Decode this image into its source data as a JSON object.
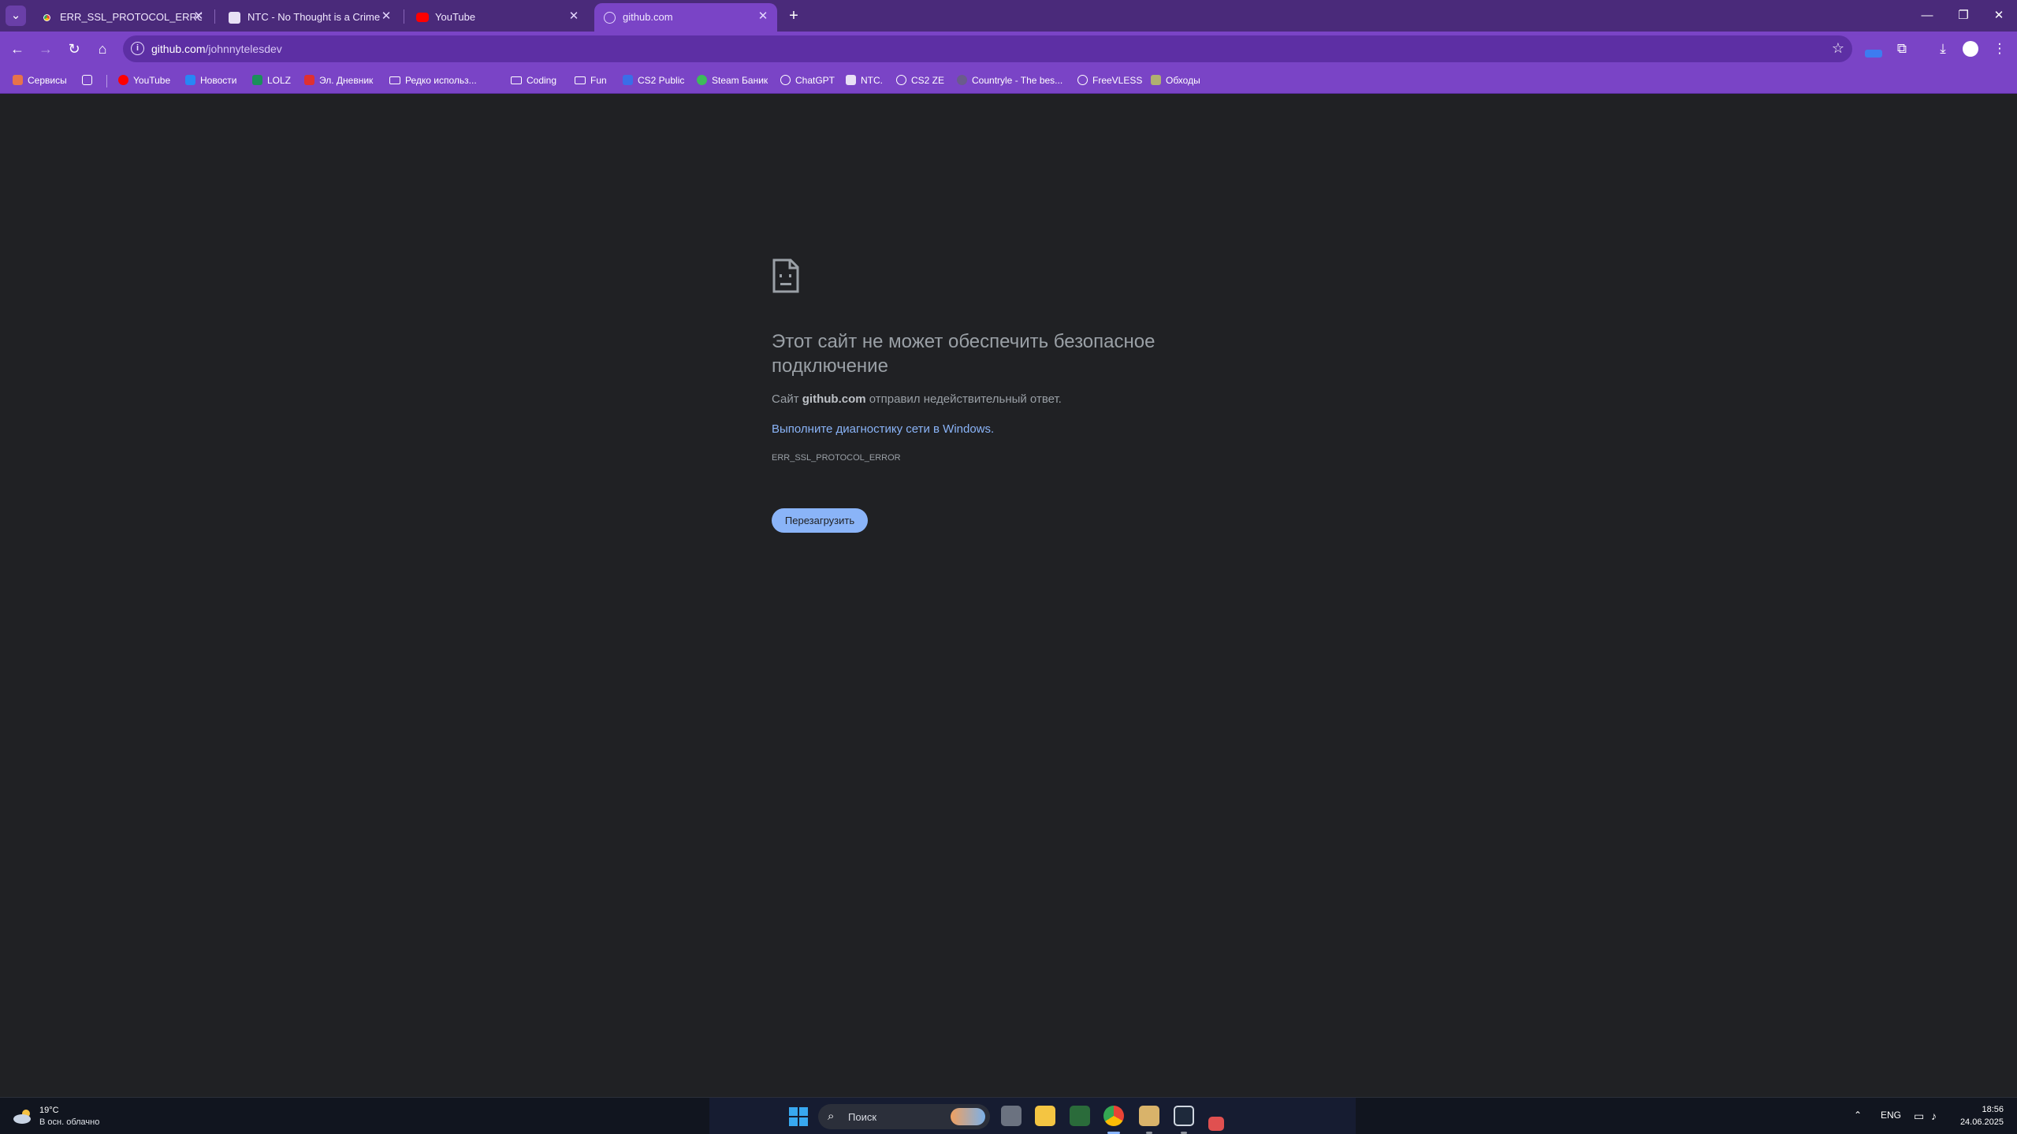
{
  "tabs": [
    {
      "title": "ERR_SSL_PROTOCOL_ERROR за",
      "favicon": "chrome-icon",
      "active": false
    },
    {
      "title": "NTC - No Thought is a Crime",
      "favicon": "ntc-icon",
      "active": false
    },
    {
      "title": "YouTube",
      "favicon": "youtube-icon",
      "active": false
    },
    {
      "title": "github.com",
      "favicon": "globe-icon",
      "active": true
    }
  ],
  "tab_close_glyph": "✕",
  "new_tab_glyph": "+",
  "window_controls": {
    "minimize": "—",
    "restore": "❐",
    "close": "✕"
  },
  "omnibox": {
    "host": "github.com",
    "path": "/johnnytelesdev"
  },
  "bookmarks": [
    {
      "label": "Сервисы",
      "icon": "apps-icon",
      "color": "#e8734a"
    },
    {
      "label": "",
      "icon": "grid-icon",
      "color": "#ffffff"
    },
    {
      "label": "YouTube",
      "icon": "youtube-icon",
      "color": "#ff0000"
    },
    {
      "label": "Новости",
      "icon": "vk-icon",
      "color": "#2787f5"
    },
    {
      "label": "LOLZ",
      "icon": "lolz-icon",
      "color": "#1a8f5a"
    },
    {
      "label": "Эл. Дневник",
      "icon": "diary-icon",
      "color": "#e03030"
    },
    {
      "label": "Редко использ...",
      "icon": "folder-icon",
      "color": "#ffffff"
    },
    {
      "label": "Coding",
      "icon": "folder-icon",
      "color": "#ffffff"
    },
    {
      "label": "Fun",
      "icon": "folder-icon",
      "color": "#ffffff"
    },
    {
      "label": "CS2 Public",
      "icon": "cs2-icon",
      "color": "#3a6ee8"
    },
    {
      "label": "Steam Баник",
      "icon": "steam-icon",
      "color": "#3dbb5a"
    },
    {
      "label": "ChatGPT",
      "icon": "chatgpt-icon",
      "color": "#ffffff"
    },
    {
      "label": "NTC.",
      "icon": "ntc-icon",
      "color": "#ffffff"
    },
    {
      "label": "CS2 ZE",
      "icon": "globe-icon",
      "color": "#ffffff"
    },
    {
      "label": "Countryle - The bes...",
      "icon": "countryle-icon",
      "color": "#6a5b8c"
    },
    {
      "label": "FreeVLESS",
      "icon": "globe-icon",
      "color": "#ffffff"
    },
    {
      "label": "Обходы",
      "icon": "obhody-icon",
      "color": "#b0b070"
    }
  ],
  "error": {
    "title": "Этот сайт не может обеспечить безопасное подключение",
    "msg_prefix": "Сайт",
    "msg_host": "github.com",
    "msg_suffix": "отправил недействительный ответ.",
    "link": "Выполните диагностику сети в Windows.",
    "code": "ERR_SSL_PROTOCOL_ERROR",
    "reload": "Перезагрузить"
  },
  "taskbar": {
    "weather_temp": "19°C",
    "weather_desc": "В осн. облачно",
    "search_placeholder": "Поиск",
    "lang": "ENG",
    "time": "18:56",
    "date": "24.06.2025"
  }
}
